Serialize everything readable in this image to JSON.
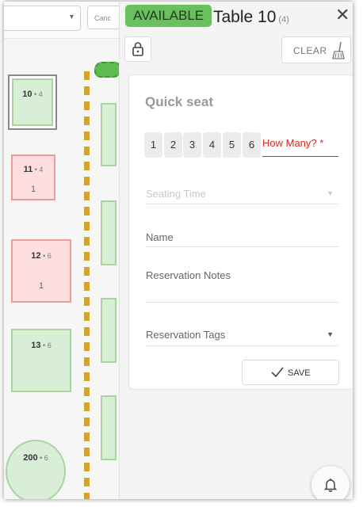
{
  "floor": {
    "cancel_label": "Canc",
    "tables": [
      {
        "name": "10",
        "seats": "4",
        "count": ""
      },
      {
        "name": "11",
        "seats": "4",
        "count": "1"
      },
      {
        "name": "12",
        "seats": "6",
        "count": "1"
      },
      {
        "name": "13",
        "seats": "6",
        "count": ""
      },
      {
        "name": "200",
        "seats": "6",
        "count": ""
      }
    ],
    "colors": {
      "available": "#d9eed6",
      "occupied": "#fcdede",
      "divider": "#d4a22e"
    }
  },
  "panel": {
    "status": "AVAILABLE",
    "status_color": "#6ac05f",
    "title": "Table 10",
    "capacity": "(4)",
    "clear_label": "CLEAR",
    "icons": [
      "close-icon",
      "lock-icon",
      "broom-icon",
      "checkmark-icon",
      "bell-icon"
    ]
  },
  "quick_seat": {
    "heading": "Quick seat",
    "party_sizes": [
      "1",
      "2",
      "3",
      "4",
      "5",
      "6"
    ],
    "how_many_label": "How Many? *",
    "seating_time_label": "Seating Time",
    "name_label": "Name",
    "notes_label": "Reservation Notes",
    "tags_label": "Reservation Tags",
    "save_label": "SAVE"
  }
}
